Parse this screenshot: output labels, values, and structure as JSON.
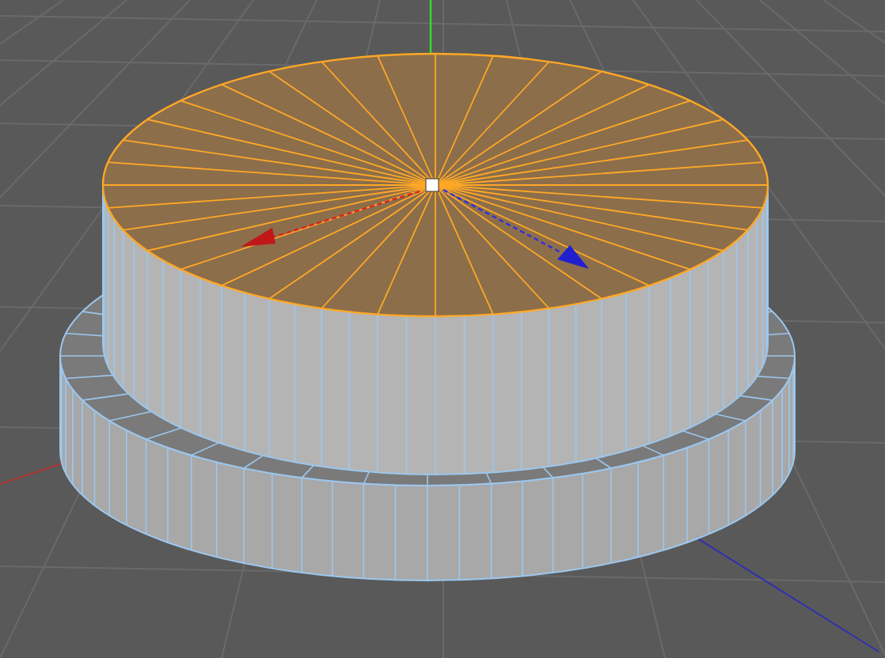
{
  "viewport": {
    "top_cap_selected": true
  }
}
